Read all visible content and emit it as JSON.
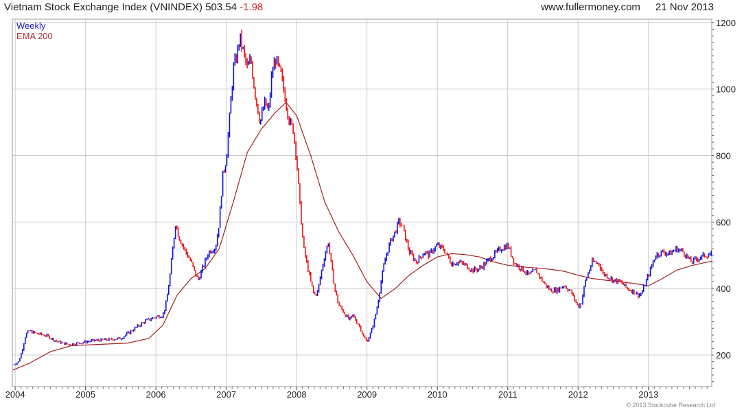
{
  "header": {
    "title": "Vietnam Stock Exchange Index (VNINDEX) 503.54",
    "change": "-1.98",
    "source": "www.fullermoney.com",
    "date": "21 Nov 2013"
  },
  "legend": {
    "weekly": "Weekly",
    "ema": "EMA 200"
  },
  "copyright": "© 2013 Stockcube Research Ltd",
  "colors": {
    "up": "#1010dd",
    "down": "#ee1111",
    "ema": "#a02020",
    "grid": "#cccccc"
  },
  "chart_data": {
    "type": "line",
    "title": "Vietnam Stock Exchange Index (VNINDEX) 503.54",
    "xlabel": "",
    "ylabel": "",
    "x_ticks": [
      "2004",
      "2005",
      "2006",
      "2007",
      "2008",
      "2009",
      "2010",
      "2011",
      "2012",
      "2013"
    ],
    "y_ticks": [
      200,
      400,
      600,
      800,
      1000,
      1200
    ],
    "ylim": [
      105,
      1210
    ],
    "xlim": [
      2003.96,
      2013.9
    ],
    "y_axis_position": "right",
    "grid": true,
    "legend_position": "top-left",
    "series": [
      {
        "name": "Weekly",
        "x": [
          2003.97,
          2004.05,
          2004.1,
          2004.15,
          2004.2,
          2004.3,
          2004.45,
          2004.6,
          2004.75,
          2004.9,
          2005.1,
          2005.3,
          2005.5,
          2005.7,
          2005.85,
          2006.0,
          2006.1,
          2006.15,
          2006.2,
          2006.25,
          2006.28,
          2006.32,
          2006.4,
          2006.5,
          2006.55,
          2006.6,
          2006.68,
          2006.75,
          2006.85,
          2006.9,
          2006.95,
          2007.0,
          2007.05,
          2007.1,
          2007.15,
          2007.18,
          2007.2,
          2007.3,
          2007.35,
          2007.4,
          2007.48,
          2007.55,
          2007.6,
          2007.65,
          2007.7,
          2007.78,
          2007.85,
          2007.9,
          2007.95,
          2008.0,
          2008.05,
          2008.1,
          2008.15,
          2008.2,
          2008.25,
          2008.3,
          2008.35,
          2008.4,
          2008.45,
          2008.5,
          2008.55,
          2008.6,
          2008.7,
          2008.75,
          2008.8,
          2008.85,
          2008.9,
          2008.95,
          2009.0,
          2009.05,
          2009.1,
          2009.15,
          2009.2,
          2009.25,
          2009.3,
          2009.35,
          2009.4,
          2009.45,
          2009.5,
          2009.6,
          2009.7,
          2009.78,
          2009.82,
          2009.88,
          2009.95,
          2010.0,
          2010.1,
          2010.2,
          2010.3,
          2010.4,
          2010.5,
          2010.6,
          2010.7,
          2010.8,
          2010.9,
          2011.0,
          2011.1,
          2011.2,
          2011.3,
          2011.4,
          2011.5,
          2011.6,
          2011.7,
          2011.8,
          2011.9,
          2012.0,
          2012.05,
          2012.1,
          2012.2,
          2012.3,
          2012.35,
          2012.4,
          2012.5,
          2012.6,
          2012.7,
          2012.8,
          2012.85,
          2012.9,
          2013.0,
          2013.1,
          2013.2,
          2013.3,
          2013.4,
          2013.5,
          2013.6,
          2013.7,
          2013.8,
          2013.9
        ],
        "y": [
          170,
          180,
          215,
          262,
          272,
          265,
          258,
          240,
          232,
          236,
          243,
          246,
          250,
          280,
          302,
          315,
          320,
          360,
          440,
          540,
          600,
          560,
          520,
          480,
          450,
          425,
          470,
          510,
          525,
          600,
          740,
          790,
          920,
          1060,
          1100,
          1140,
          1150,
          1060,
          1090,
          1000,
          900,
          960,
          930,
          1050,
          1090,
          1040,
          960,
          900,
          880,
          790,
          640,
          520,
          470,
          420,
          380,
          390,
          450,
          500,
          540,
          460,
          390,
          350,
          320,
          305,
          320,
          300,
          285,
          255,
          240,
          265,
          300,
          350,
          420,
          480,
          520,
          550,
          570,
          600,
          590,
          510,
          480,
          500,
          510,
          500,
          520,
          530,
          515,
          475,
          480,
          470,
          455,
          460,
          480,
          500,
          520,
          530,
          475,
          460,
          440,
          455,
          420,
          395,
          395,
          410,
          390,
          345,
          360,
          420,
          480,
          475,
          445,
          440,
          425,
          420,
          400,
          390,
          380,
          385,
          440,
          500,
          510,
          505,
          520,
          510,
          480,
          490,
          500,
          503
        ]
      },
      {
        "name": "EMA 200",
        "x": [
          2003.97,
          2004.2,
          2004.5,
          2004.8,
          2005.2,
          2005.6,
          2005.9,
          2006.1,
          2006.3,
          2006.5,
          2006.7,
          2006.9,
          2007.1,
          2007.3,
          2007.5,
          2007.7,
          2007.85,
          2008.0,
          2008.2,
          2008.4,
          2008.6,
          2008.8,
          2009.0,
          2009.2,
          2009.4,
          2009.6,
          2009.8,
          2010.0,
          2010.2,
          2010.4,
          2010.6,
          2010.8,
          2011.0,
          2011.2,
          2011.4,
          2011.6,
          2011.8,
          2012.0,
          2012.2,
          2012.4,
          2012.6,
          2012.8,
          2013.0,
          2013.2,
          2013.4,
          2013.6,
          2013.8,
          2013.9
        ],
        "y": [
          155,
          175,
          210,
          228,
          232,
          236,
          250,
          290,
          380,
          430,
          460,
          520,
          660,
          810,
          880,
          930,
          960,
          920,
          800,
          660,
          570,
          500,
          420,
          370,
          400,
          440,
          470,
          495,
          505,
          502,
          495,
          480,
          470,
          465,
          462,
          458,
          452,
          440,
          430,
          425,
          420,
          415,
          408,
          430,
          455,
          468,
          478,
          482
        ]
      }
    ]
  }
}
